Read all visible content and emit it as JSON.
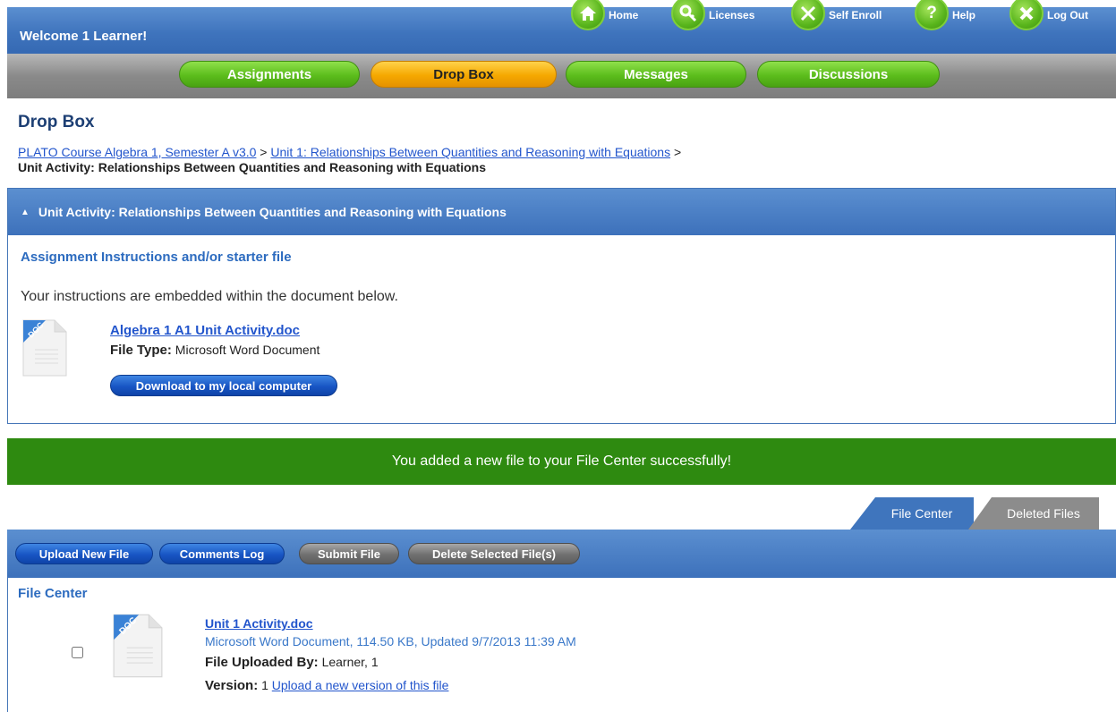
{
  "header": {
    "welcome": "Welcome 1 Learner!",
    "nav": [
      {
        "label": "Home",
        "icon": "home-icon"
      },
      {
        "label": "Licenses",
        "icon": "key-icon"
      },
      {
        "label": "Self Enroll",
        "icon": "tools-icon"
      },
      {
        "label": "Help",
        "icon": "help-icon"
      },
      {
        "label": "Log Out",
        "icon": "logout-icon"
      }
    ]
  },
  "tabs": [
    {
      "label": "Assignments",
      "active": false
    },
    {
      "label": "Drop Box",
      "active": true
    },
    {
      "label": "Messages",
      "active": false
    },
    {
      "label": "Discussions",
      "active": false
    }
  ],
  "page": {
    "title": "Drop Box",
    "breadcrumb": {
      "links": [
        "PLATO Course Algebra 1, Semester A v3.0",
        "Unit 1: Relationships Between Quantities and Reasoning with Equations"
      ],
      "separator": ">",
      "current": "Unit Activity: Relationships Between Quantities and Reasoning with Equations"
    }
  },
  "activity": {
    "header": "Unit Activity: Relationships Between Quantities and Reasoning with Equations",
    "section_title": "Assignment Instructions and/or starter file",
    "instructions": "Your instructions are embedded within the document below.",
    "starter_file": {
      "name": "Algebra 1 A1 Unit Activity.doc",
      "type_label": "File Type:",
      "type_value": "Microsoft Word Document",
      "icon_text": "DOC",
      "download_label": "Download to my local computer"
    }
  },
  "success_message": "You added a new file to your File Center successfully!",
  "file_center": {
    "tabs": [
      {
        "label": "File Center",
        "active": true
      },
      {
        "label": "Deleted Files",
        "active": false
      }
    ],
    "toolbar": {
      "upload": "Upload New File",
      "comments": "Comments Log",
      "submit": "Submit File",
      "delete": "Delete Selected File(s)"
    },
    "title": "File Center",
    "files": [
      {
        "name": "Unit 1 Activity.doc",
        "meta": "Microsoft Word Document, 114.50 KB, Updated 9/7/2013 11:39 AM",
        "uploaded_label": "File Uploaded By:",
        "uploaded_value": "Learner, 1",
        "version_label": "Version:",
        "version_value": "1",
        "upload_version_link": "Upload a new version of this file",
        "icon_text": "DOC",
        "selected": false
      }
    ]
  },
  "colors": {
    "accent_blue": "#3f75bd",
    "success_green": "#2e8a10",
    "tab_green": "#5cbd1c",
    "tab_orange": "#f5a800"
  }
}
